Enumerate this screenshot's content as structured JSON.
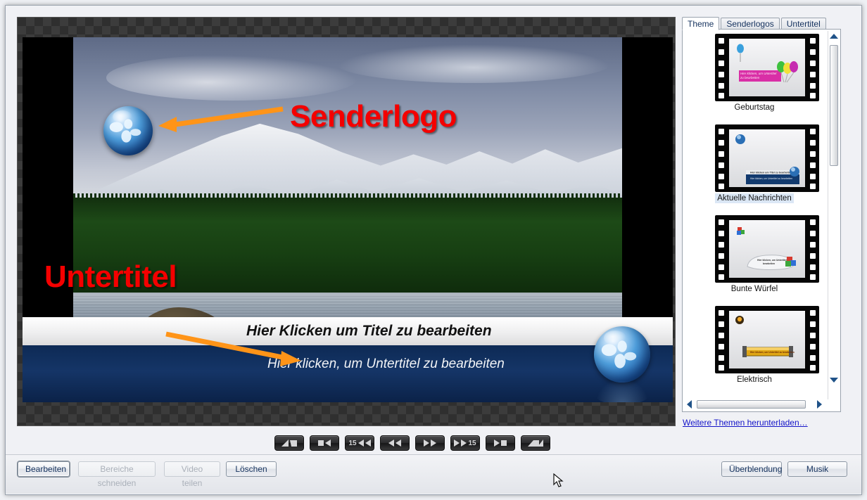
{
  "preview": {
    "title_text": "Hier Klicken um Titel zu bearbeiten",
    "subtitle_text": "Hier klicken, um Untertitel zu bearbeiten",
    "annotations": [
      {
        "id": "senderlogo",
        "label": "Senderlogo"
      },
      {
        "id": "untertitel",
        "label": "Untertitel"
      }
    ],
    "logo_icon": "globe-icon",
    "annotation_color": "#f40000",
    "arrow_color": "#ff9418"
  },
  "theme_panel": {
    "tabs": [
      {
        "label": "Theme",
        "active": true
      },
      {
        "label": "Senderlogos",
        "active": false
      },
      {
        "label": "Untertitel",
        "active": false
      }
    ],
    "themes": [
      {
        "name": "Geburtstag",
        "selected": false,
        "icon": "balloon-icon"
      },
      {
        "name": "Aktuelle Nachrichten",
        "selected": true,
        "icon": "globe-icon"
      },
      {
        "name": "Bunte Würfel",
        "selected": false,
        "icon": "cubes-icon"
      },
      {
        "name": "Elektrisch",
        "selected": false,
        "icon": "bulb-icon"
      }
    ],
    "download_link": "Weitere Themen herunterladen…"
  },
  "transport": {
    "buttons": [
      {
        "name": "mark-in-button",
        "glyph": "mark-in"
      },
      {
        "name": "previous-frame-button",
        "glyph": "stop-prev"
      },
      {
        "name": "back-15-button",
        "glyph": "back-15",
        "value": "15"
      },
      {
        "name": "rewind-button",
        "glyph": "rewind"
      },
      {
        "name": "forward-button",
        "glyph": "forward"
      },
      {
        "name": "forward-15-button",
        "glyph": "fwd-15",
        "value": "15"
      },
      {
        "name": "next-frame-button",
        "glyph": "play-stop"
      },
      {
        "name": "mark-out-button",
        "glyph": "mark-out"
      }
    ]
  },
  "bottom_bar": {
    "left_buttons": [
      {
        "label": "Bearbeiten",
        "enabled": true,
        "focused": true
      },
      {
        "label": "Bereiche schneiden",
        "enabled": false,
        "focused": false
      },
      {
        "label": "Video teilen",
        "enabled": false,
        "focused": false
      },
      {
        "label": "Löschen",
        "enabled": true,
        "focused": false
      }
    ],
    "right_buttons": [
      {
        "label": "Überblendung",
        "enabled": true
      },
      {
        "label": "Musik",
        "enabled": true
      }
    ]
  }
}
